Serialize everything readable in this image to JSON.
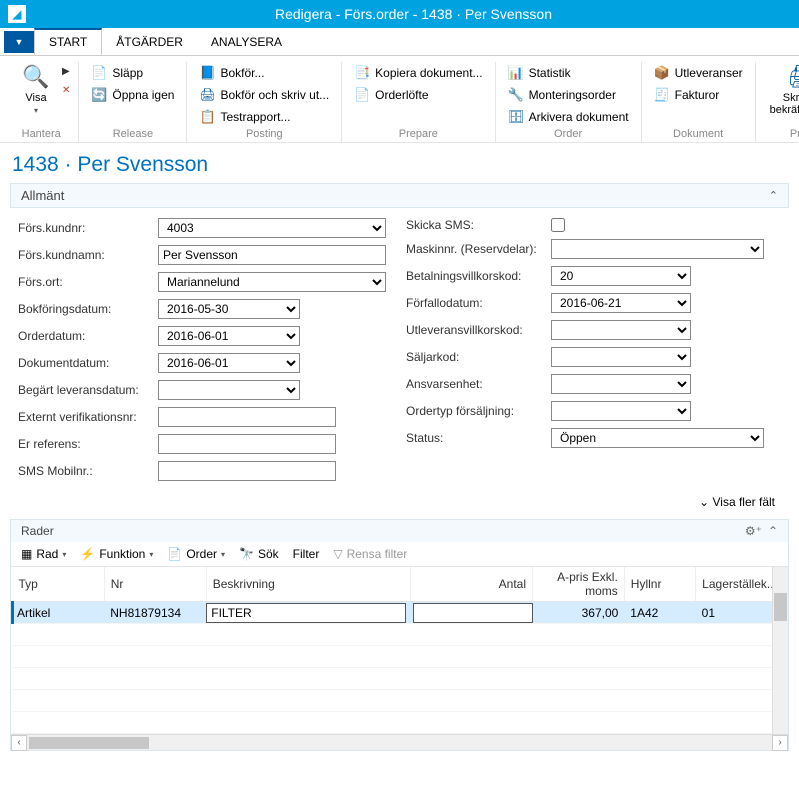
{
  "window": {
    "title": "Redigera - Förs.order - 1438 · Per Svensson"
  },
  "tabs": {
    "start": "START",
    "atg": "ÅTGÄRDER",
    "ana": "ANALYSERA"
  },
  "ribbon": {
    "hantera": {
      "visa": "Visa",
      "group": "Hantera"
    },
    "release": {
      "slapp": "Släpp",
      "oppna": "Öppna igen",
      "group": "Release"
    },
    "posting": {
      "bokfor": "Bokför...",
      "bokforskriv": "Bokför och skriv ut...",
      "testrapport": "Testrapport...",
      "group": "Posting"
    },
    "prepare": {
      "kopiera": "Kopiera dokument...",
      "orderlofte": "Orderlöfte",
      "group": "Prepare"
    },
    "order": {
      "statistik": "Statistik",
      "monterings": "Monteringsorder",
      "arkivera": "Arkivera dokument",
      "group": "Order"
    },
    "dokument": {
      "utlev": "Utleveranser",
      "fakturor": "Fakturor",
      "group": "Dokument"
    },
    "print": {
      "skriv": "Skriv ut bekräftelse...",
      "group": "Print"
    }
  },
  "page": {
    "title": "1438 · Per Svensson",
    "allmant": "Allmänt"
  },
  "form": {
    "left": {
      "kundnr": {
        "lbl": "Förs.kundnr:",
        "val": "4003"
      },
      "kundnamn": {
        "lbl": "Förs.kundnamn:",
        "val": "Per Svensson"
      },
      "ort": {
        "lbl": "Förs.ort:",
        "val": "Mariannelund"
      },
      "bokdatum": {
        "lbl": "Bokföringsdatum:",
        "val": "2016-05-30"
      },
      "orderdatum": {
        "lbl": "Orderdatum:",
        "val": "2016-06-01"
      },
      "dokdatum": {
        "lbl": "Dokumentdatum:",
        "val": "2016-06-01"
      },
      "levdatum": {
        "lbl": "Begärt leveransdatum:",
        "val": ""
      },
      "extver": {
        "lbl": "Externt verifikationsnr:",
        "val": ""
      },
      "erref": {
        "lbl": "Er referens:",
        "val": ""
      },
      "sms": {
        "lbl": "SMS Mobilnr.:",
        "val": ""
      }
    },
    "right": {
      "skicka": {
        "lbl": "Skicka SMS:"
      },
      "maskin": {
        "lbl": "Maskinnr. (Reservdelar):",
        "val": ""
      },
      "betvillkor": {
        "lbl": "Betalningsvillkorskod:",
        "val": "20"
      },
      "forfallo": {
        "lbl": "Förfallodatum:",
        "val": "2016-06-21"
      },
      "utlvillkor": {
        "lbl": "Utleveransvillkorskod:",
        "val": ""
      },
      "saljarkod": {
        "lbl": "Säljarkod:",
        "val": ""
      },
      "ansvar": {
        "lbl": "Ansvarsenhet:",
        "val": ""
      },
      "ordertyp": {
        "lbl": "Ordertyp försäljning:",
        "val": ""
      },
      "status": {
        "lbl": "Status:",
        "val": "Öppen"
      }
    }
  },
  "showmore": "Visa fler fält",
  "rader": {
    "title": "Rader",
    "toolbar": {
      "rad": "Rad",
      "funktion": "Funktion",
      "order": "Order",
      "sok": "Sök",
      "filter": "Filter",
      "rensa": "Rensa filter"
    },
    "cols": {
      "typ": "Typ",
      "nr": "Nr",
      "besk": "Beskrivning",
      "antal": "Antal",
      "apris": "A-pris Exkl. moms",
      "hyllnr": "Hyllnr",
      "lager": "Lagerställek..."
    },
    "row": {
      "typ": "Artikel",
      "nr": "NH81879134",
      "besk": "FILTER",
      "antal": "",
      "apris": "367,00",
      "hyllnr": "1A42",
      "lager": "01"
    }
  }
}
